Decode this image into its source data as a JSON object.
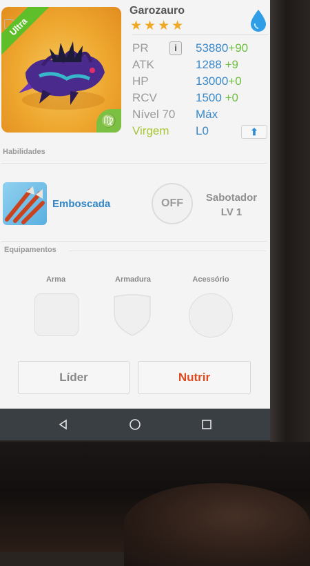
{
  "monster": {
    "name": "Garozauro",
    "rarity": "Ultra",
    "stars": 4,
    "element_icon": "water-drop-icon",
    "sign_glyph": "♍",
    "portrait_icon": "dragon-portrait"
  },
  "stats": [
    {
      "label": "PR",
      "value": "53880",
      "bonus": "+90",
      "has_info": true
    },
    {
      "label": "ATK",
      "value": "1288",
      "bonus": "+9"
    },
    {
      "label": "HP",
      "value": "13000",
      "bonus": "+0"
    },
    {
      "label": "RCV",
      "value": "1500",
      "bonus": "+0"
    },
    {
      "label": "Nível 70",
      "value": "Máx",
      "bonus": ""
    },
    {
      "label": "Virgem",
      "value": "L0",
      "bonus": "",
      "has_upgrade": true
    }
  ],
  "info_button": "i",
  "upgrade_button": "⬆",
  "skills": {
    "title": "Habilidades",
    "skill_name": "Emboscada",
    "toggle": "OFF",
    "class_name": "Sabotador",
    "class_level": "LV 1"
  },
  "equipment": {
    "title": "Equipamentos",
    "slots": [
      "Arma",
      "Armadura",
      "Acessório"
    ]
  },
  "buttons": {
    "leader": "Líder",
    "feed": "Nutrir"
  },
  "colors": {
    "accent_blue": "#3a88c9",
    "bonus_green": "#6dbf3d",
    "feed_red": "#e04a1f",
    "star_gold": "#f0a823"
  }
}
